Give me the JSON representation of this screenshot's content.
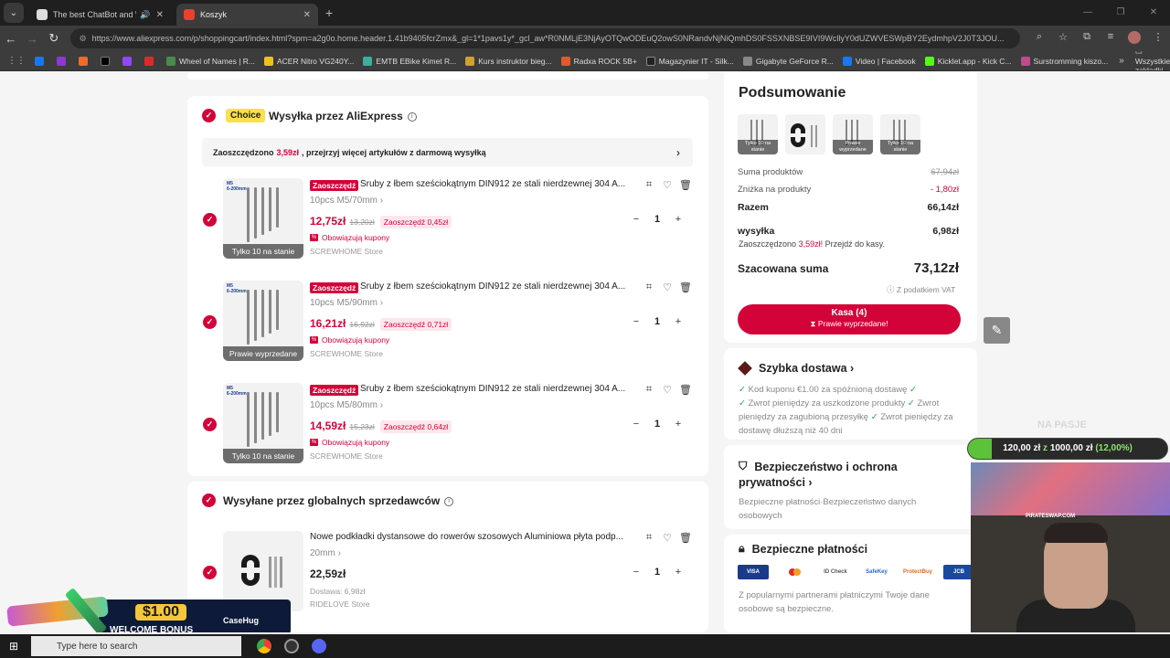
{
  "browser": {
    "tabs": [
      {
        "title": "The best ChatBot and Widg",
        "active": false
      },
      {
        "title": "Koszyk",
        "active": true
      }
    ],
    "url": "https://www.aliexpress.com/p/shoppingcart/index.html?spm=a2g0o.home.header.1.41b9405fcrZmx&_gl=1*1pavs1y*_gcl_aw*R0NMLjE3NjAyOTQwODEuQ2owS0NRandvNjNiQmhDS0FSSXNBSE9IVI9WcllyY0dUZWVESWpBY2EydmhpV2J0T3JOU...",
    "bookmarks": [
      "Wheel of Names | R...",
      "ACER Nitro VG240Y...",
      "EMTB EBike Kimet R...",
      "Kurs instruktor bieg...",
      "Radxa ROCK 5B+",
      "Magazynier IT - Silk...",
      "Gigabyte GeForce R...",
      "Video | Facebook",
      "Kicklet.app - Kick C...",
      "Surstromming kiszo..."
    ],
    "bookmarks_folder": "Wszystkie zakładki"
  },
  "cart": {
    "choice_badge": "Choice",
    "choice_section_title": "Wysyłka przez AliExpress",
    "promo": {
      "prefix": "Zaoszczędzono",
      "amount": "3,59zł",
      "suffix": ", przejrzyj więcej artykułów z darmową wysyłką"
    },
    "sale_tag": "Zaoszczędź",
    "coupon_text": "Obowiązują kupony",
    "items": [
      {
        "title": "Śruby z łbem sześciokątnym DIN912 ze stali nierdzewnej 304 A...",
        "variant": "10pcs M5/70mm",
        "price": "12,75zł",
        "old_price": "13,20zł",
        "saving": "Zaoszczędź 0,45zł",
        "store": "SCREWHOME Store",
        "stock": "Tylko 10 na stanie",
        "qty": "1"
      },
      {
        "title": "Śruby z łbem sześciokątnym DIN912 ze stali nierdzewnej 304 A...",
        "variant": "10pcs M5/90mm",
        "price": "16,21zł",
        "old_price": "16,92zł",
        "saving": "Zaoszczędź 0,71zł",
        "store": "SCREWHOME Store",
        "stock": "Prawie wyprzedane",
        "qty": "1"
      },
      {
        "title": "Śruby z łbem sześciokątnym DIN912 ze stali nierdzewnej 304 A...",
        "variant": "10pcs M5/80mm",
        "price": "14,59zł",
        "old_price": "15,23zł",
        "saving": "Zaoszczędź 0,64zł",
        "store": "SCREWHOME Store",
        "stock": "Tylko 10 na stanie",
        "qty": "1"
      }
    ],
    "global_section_title": "Wysyłane przez globalnych sprzedawców",
    "global_item": {
      "title": "Nowe podkładki dystansowe do rowerów szosowych Aluminiowa płyta podp...",
      "variant": "20mm",
      "price": "22,59zł",
      "shipping": "Dostawa: 6,98zł",
      "store": "RIDELOVE Store",
      "qty": "1"
    }
  },
  "summary": {
    "title": "Podsumowanie",
    "thumb_labels": [
      "Tylko 10 na stanie",
      "",
      "Prawie wyprzedane",
      "Tylko 10 na stanie"
    ],
    "products_label": "Suma produktów",
    "products_value": "67,94zł",
    "discount_label": "Zniżka na produkty",
    "discount_value": "- 1,80zł",
    "subtotal_label": "Razem",
    "subtotal_value": "66,14zł",
    "shipping_label": "wysyłka",
    "shipping_value": "6,98zł",
    "shipping_saved_prefix": "Zaoszczędzono",
    "shipping_saved_amount": "3,59zł!",
    "shipping_saved_suffix": "Przejdź do kasy.",
    "total_label": "Szacowana suma",
    "total_value": "73,12zł",
    "vat_note": "Z podatkiem VAT",
    "checkout_label": "Kasa (4)",
    "checkout_sub": "Prawie wyprzedane!"
  },
  "delivery": {
    "title": "Szybka dostawa",
    "coupon_line": "Kod kuponu €1.00 za spóźnioną dostawę",
    "refund_damaged": "Zwrot pieniędzy za uszkodzone produkty",
    "refund_lost": "Zwrot pieniędzy za zagubioną przesyłkę",
    "refund_late": "Zwrot pieniędzy za dostawę dłuższą niż 40 dni"
  },
  "security": {
    "title_line1": "Bezpieczeństwo i ochrona",
    "title_line2": "prywatności",
    "text": "Bezpieczne płatności·Bezpieczeństwo danych osobowych"
  },
  "payments": {
    "title": "Bezpieczne płatności",
    "icons": [
      "VISA",
      "",
      "ID Check",
      "SafeKey",
      "ProtectBuy",
      "JCB"
    ],
    "text": "Z popularnymi partnerami płatniczymi Twoje dane osobowe są bezpieczne."
  },
  "stream": {
    "label": "NA PASJE",
    "goal_current": "120,00 zł",
    "goal_sep": "z",
    "goal_target": "1000,00 zł",
    "goal_percent": "(12,00%)",
    "goal_fraction": 0.12,
    "webcam_brand": "PIRATESWAP.COM",
    "bonus_amount": "$1.00",
    "bonus_text": "WELCOME BONUS",
    "bonus_brand": "CaseHug"
  },
  "taskbar": {
    "search_placeholder": "Type here to search"
  }
}
